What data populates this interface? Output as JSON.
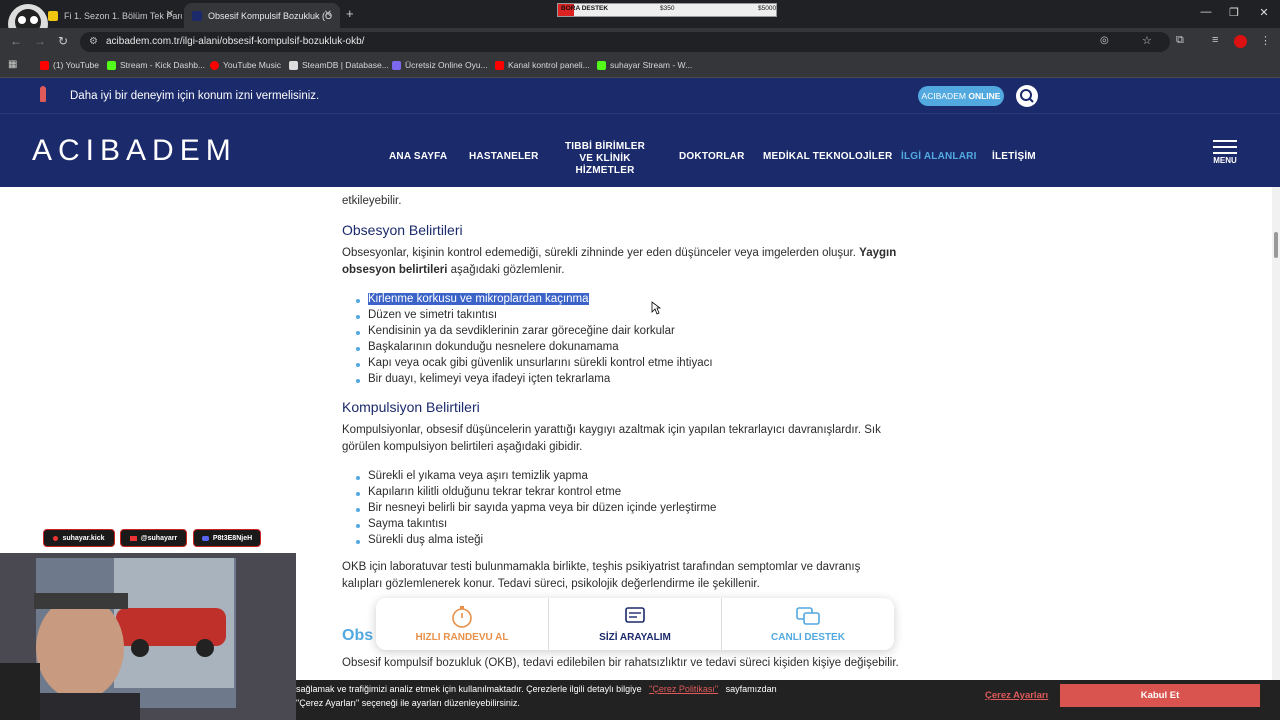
{
  "browser": {
    "tabs": [
      {
        "title": "Fi 1. Sezon 1. Bölüm Tek Parça |",
        "active": false
      },
      {
        "title": "Obsesif Kompulsif Bozukluk (O",
        "active": true
      }
    ],
    "new_tab_label": "+",
    "url": "acibadem.com.tr/ilgi-alani/obsesif-kompulsif-bozukluk-okb/",
    "bookmarks": [
      {
        "label": "(1) YouTube",
        "icon": "youtube-icon",
        "color": "#ff0000"
      },
      {
        "label": "Stream - Kick Dashb...",
        "icon": "kick-icon",
        "color": "#53fc18"
      },
      {
        "label": "YouTube Music",
        "icon": "youtube-music-icon",
        "color": "#ff0000"
      },
      {
        "label": "SteamDB | Database...",
        "icon": "steamdb-icon",
        "color": "#dddddd"
      },
      {
        "label": "Ücretsiz Online Oyu...",
        "icon": "game-icon",
        "color": "#7b68ee"
      },
      {
        "label": "Kanal kontrol paneli...",
        "icon": "youtube-icon",
        "color": "#ff0000"
      },
      {
        "label": "suhayar Stream - W...",
        "icon": "kick-icon",
        "color": "#53fc18"
      }
    ],
    "donation_bar": {
      "label": "BORA DESTEK",
      "current": "$350",
      "goal": "$5000"
    }
  },
  "site": {
    "notice": "Daha iyi bir deneyim için konum izni vermelisiniz.",
    "online_button": {
      "brand": "ACIBADEM",
      "suffix": "ONLINE"
    },
    "logo": "ACIBADEM",
    "nav": [
      {
        "label": "ANA SAYFA",
        "active": false
      },
      {
        "label": "HASTANELER",
        "active": false
      },
      {
        "label_line1": "TIBBİ BİRİMLER",
        "label_line2": "VE KLİNİK HİZMETLER",
        "active": false
      },
      {
        "label": "DOKTORLAR",
        "active": false
      },
      {
        "label": "MEDİKAL TEKNOLOJİLER",
        "active": false
      },
      {
        "label": "İLGİ ALANLARI",
        "active": true
      },
      {
        "label": "İLETİŞİM",
        "active": false
      }
    ],
    "menu_label": "MENU"
  },
  "article": {
    "top_fragment": "etkileyebilir.",
    "section1_title": "Obsesyon Belirtileri",
    "section1_intro_a": "Obsesyonlar, kişinin kontrol edemediği, sürekli zihninde yer eden düşünceler veya imgelerden oluşur.",
    "section1_intro_bold": "Yaygın obsesyon belirtileri",
    "section1_intro_b": "aşağıdaki gözlemlenir.",
    "section1_items": [
      "Kirlenme korkusu ve mikroplardan kaçınma",
      "Düzen ve simetri takıntısı",
      "Kendisinin ya da sevdiklerinin zarar göreceğine dair korkular",
      "Başkalarının dokunduğu nesnelere dokunamama",
      "Kapı veya ocak gibi güvenlik unsurlarını sürekli kontrol etme ihtiyacı",
      "Bir duayı, kelimeyi veya ifadeyi içten tekrarlama"
    ],
    "section2_title": "Kompulsiyon Belirtileri",
    "section2_intro": "Kompulsiyonlar, obsesif düşüncelerin yarattığı kaygıyı azaltmak için yapılan tekrarlayıcı davranışlardır. Sık görülen kompulsiyon belirtileri aşağıdaki gibidir.",
    "section2_items": [
      "Sürekli el yıkama veya aşırı temizlik yapma",
      "Kapıların kilitli olduğunu tekrar tekrar kontrol etme",
      "Bir nesneyi belirli bir sayıda yapma veya bir düzen içinde yerleştirme",
      "Sayma takıntısı",
      "Sürekli duş alma isteği"
    ],
    "diagnosis_text": "OKB için laboratuvar testi bulunmamakla birlikte, teşhis psikiyatrist tarafından semptomlar ve davranış kalıpları gözlemlenerek konur. Tedavi süreci, psikolojik değerlendirme ile şekillenir.",
    "section3_title_partial": "Obs",
    "bottom_text": "Obsesif kompulsif bozukluk (OKB), tedavi edilebilen bir rahatsızlıktır ve tedavi süreci kişiden kişiye değişebilir."
  },
  "widget": {
    "items": [
      {
        "label": "HIZLI RANDEVU AL",
        "icon": "stopwatch-icon",
        "color": "#e8914a"
      },
      {
        "label": "SİZİ ARAYALIM",
        "icon": "form-icon",
        "color": "#1b2a6b"
      },
      {
        "label": "CANLI DESTEK",
        "icon": "chat-icon",
        "color": "#52a9e0"
      }
    ]
  },
  "cookie": {
    "line1_a": "sağlamak ve trafiğimizi analiz etmek için kullanılmaktadır. Çerezlerle ilgili detaylı bilgiye",
    "line1_link": "\"Çerez Politikası\"",
    "line1_b": "sayfamızdan",
    "line2": "\"Çerez Ayarları\" seçeneği ile ayarları düzenleyebilirsiniz.",
    "settings_label": "Çerez Ayarları",
    "accept_label": "Kabul Et"
  },
  "stream": {
    "socials": [
      {
        "label": "suhayar.kick"
      },
      {
        "label": "@suhayarr"
      },
      {
        "label": "P8t3E8NjeH"
      }
    ]
  },
  "colors": {
    "brand_navy": "#1b2a6b",
    "accent_blue": "#52a9e0",
    "accept_red": "#d9534f"
  }
}
